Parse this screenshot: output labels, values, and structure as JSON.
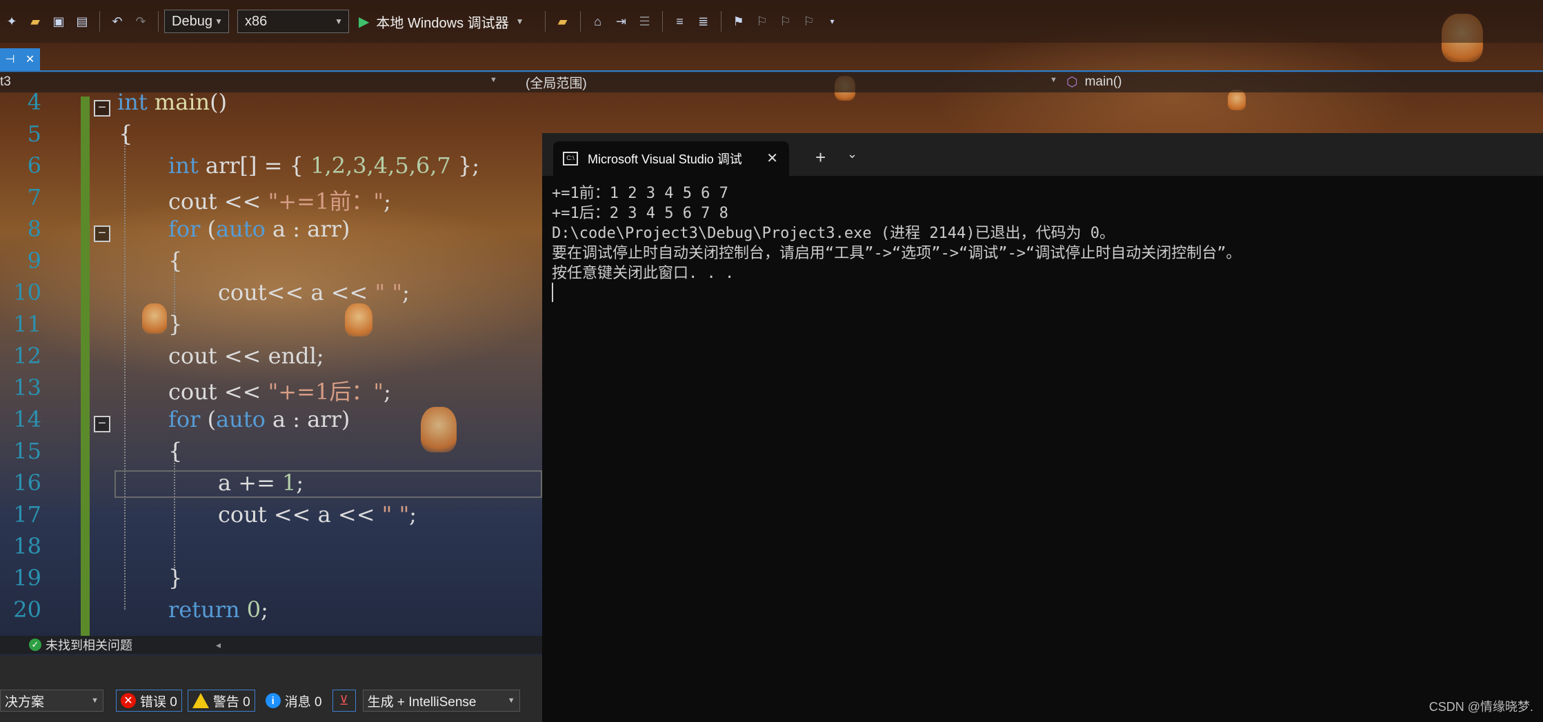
{
  "toolbar": {
    "config": "Debug",
    "platform": "x86",
    "run_label": "本地 Windows 调试器"
  },
  "tab": {
    "pin_glyph": "⊣",
    "close_glyph": "✕"
  },
  "navbar": {
    "project": "t3",
    "scope": "(全局范围)",
    "member": "main()"
  },
  "editor": {
    "lines": [
      {
        "n": "4"
      },
      {
        "n": "5"
      },
      {
        "n": "6"
      },
      {
        "n": "7"
      },
      {
        "n": "8"
      },
      {
        "n": "9"
      },
      {
        "n": "10"
      },
      {
        "n": "11"
      },
      {
        "n": "12"
      },
      {
        "n": "13"
      },
      {
        "n": "14"
      },
      {
        "n": "15"
      },
      {
        "n": "16"
      },
      {
        "n": "17"
      },
      {
        "n": "18"
      },
      {
        "n": "19"
      },
      {
        "n": "20"
      }
    ],
    "code": {
      "l4_kw": "int",
      "l4_fn": " main",
      "l4_rest": "()",
      "l5": "{",
      "l6_kw": "int",
      "l6_rest": " arr[] = { ",
      "l6_nums": "1,2,3,4,5,6,7",
      "l6_end": " };",
      "l7_a": "cout << ",
      "l7_str": "\"+=1前：\"",
      "l7_end": ";",
      "l8_kw": "for",
      "l8_b": " (",
      "l8_kw2": "auto",
      "l8_rest": " a : arr)",
      "l9": "{",
      "l10_a": "cout<< a << ",
      "l10_str": "\" \"",
      "l10_end": ";",
      "l11": "}",
      "l12": "cout << endl;",
      "l13_a": "cout << ",
      "l13_str": "\"+=1后：\"",
      "l13_end": ";",
      "l14_kw": "for",
      "l14_b": " (",
      "l14_kw2": "auto",
      "l14_rest": " a : arr)",
      "l15": "{",
      "l16_a": "a += ",
      "l16_num": "1",
      "l16_end": ";",
      "l17_a": "cout << a << ",
      "l17_str": "\" \"",
      "l17_end": ";",
      "l19": "}",
      "l20_kw": "return",
      "l20_sp": " ",
      "l20_num": "0",
      "l20_end": ";"
    }
  },
  "issues": {
    "status": "未找到相关问题"
  },
  "error_list": {
    "scope": "决方案",
    "errors": "错误 0",
    "warnings": "警告 0",
    "messages": "消息 0",
    "source": "生成 + IntelliSense"
  },
  "console": {
    "tab_title": "Microsoft Visual Studio 调试",
    "lines": [
      "+=1前：1 2 3 4 5 6 7",
      "+=1后：2 3 4 5 6 7 8",
      "D:\\code\\Project3\\Debug\\Project3.exe (进程 2144)已退出，代码为 0。",
      "要在调试停止时自动关闭控制台，请启用“工具”->“选项”->“调试”->“调试停止时自动关闭控制台”。",
      "按任意键关闭此窗口. . ."
    ]
  },
  "watermark": "CSDN @情缘晓梦."
}
